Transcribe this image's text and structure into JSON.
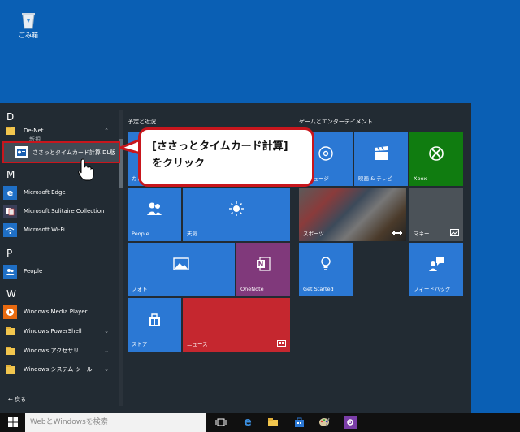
{
  "desktop": {
    "recycle_label": "ごみ箱"
  },
  "applist": {
    "letters": [
      "D",
      "M",
      "P",
      "W"
    ],
    "denet": {
      "label": "De-Net",
      "sub": "新規"
    },
    "apps": {
      "edge": "Microsoft Edge",
      "solitaire": "Microsoft Solitaire Collection",
      "wifi": "Microsoft Wi-Fi",
      "people": "People",
      "wmp": "Windows Media Player",
      "powershell": "Windows PowerShell",
      "accessories": "Windows アクセサリ",
      "system": "Windows システム ツール"
    },
    "highlighted_app": "ささっとタイムカード計算 DL版",
    "back_label": "戻る"
  },
  "sections": {
    "left": "予定と近況",
    "right": "ゲームとエンターテイメント"
  },
  "tiles": {
    "calendar": "カレ",
    "mail": "",
    "people": "People",
    "weather": "天気",
    "photos": "フォト",
    "onenote": "OneNote",
    "store": "ストア",
    "news": "ニュース",
    "groove": "e ミュージ",
    "movies": "映画 & テレビ",
    "xbox": "Xbox",
    "sports": "スポーツ",
    "money": "マネー",
    "getstarted": "Get Started",
    "feedback": "フィードバック"
  },
  "callout": {
    "line1": "[ささっとタイムカード計算]",
    "line2": "をクリック"
  },
  "taskbar": {
    "search_placeholder": "WebとWindowsを検索"
  },
  "colors": {
    "desktop": "#0a5fb4",
    "start_bg": "#222b33",
    "tile_blue": "#2b78d4",
    "onenote": "#80397b",
    "news": "#c5272f",
    "xbox": "#107c10",
    "highlight": "#c8161d"
  }
}
